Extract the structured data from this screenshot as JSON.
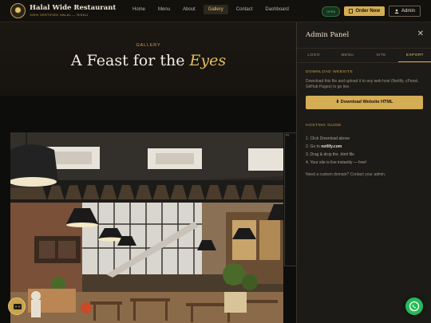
{
  "brand": {
    "name": "Halal Wide Restaurant",
    "tagline": "100% CERTIFIED HALAL — RISKLI"
  },
  "nav": {
    "links": [
      {
        "label": "Home"
      },
      {
        "label": "Menu"
      },
      {
        "label": "About"
      },
      {
        "label": "Gallery",
        "active": true
      },
      {
        "label": "Contact"
      },
      {
        "label": "Dashboard"
      }
    ],
    "status_pill": "OPEN",
    "order_label": "Order Now",
    "admin_label": "Admin"
  },
  "hero": {
    "eyebrow": "GALLERY",
    "title_main": "A Feast for the",
    "title_accent": "Eyes"
  },
  "gallery": {
    "broken_img_alt": "PI"
  },
  "admin_panel": {
    "title": "Admin Panel",
    "close_symbol": "✕",
    "tabs": [
      {
        "label": "LOGO"
      },
      {
        "label": "MENU"
      },
      {
        "label": "SITE"
      },
      {
        "label": "EXPORT",
        "active": true
      }
    ],
    "download": {
      "label": "DOWNLOAD WEBSITE",
      "description": "Download this file and upload it to any web host (Netlify, cPanel, GitHub Pages) to go live.",
      "button_label": "⬇ Download Website HTML"
    },
    "hosting": {
      "label": "HOSTING GUIDE",
      "steps": [
        {
          "prefix": "1. Click Download above",
          "bold": ""
        },
        {
          "prefix": "2. Go to ",
          "bold": "netlify.com"
        },
        {
          "prefix": "3. Drag & drop the .html file",
          "bold": ""
        },
        {
          "prefix": "4. Your site is live instantly — free!",
          "bold": ""
        }
      ],
      "footer": "Need a custom domain? Contact your admin."
    }
  },
  "colors": {
    "accent": "#d4ad55",
    "background": "#0d0d0b",
    "whatsapp": "#25b95a"
  },
  "icons": [
    "logo-emblem",
    "phone-icon",
    "user-icon",
    "close-icon",
    "download-icon",
    "whatsapp-icon",
    "chat-icon"
  ]
}
